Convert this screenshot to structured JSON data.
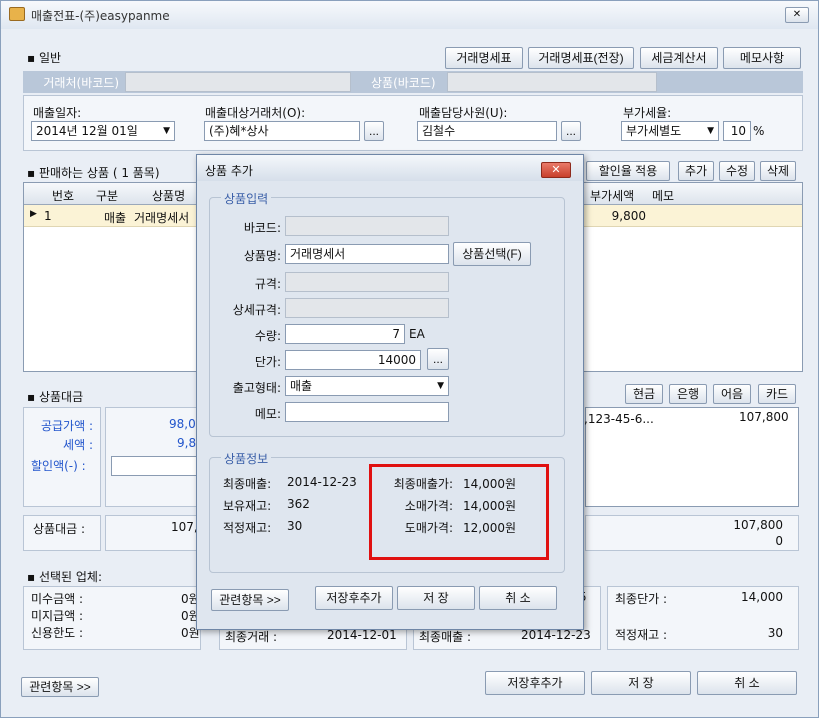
{
  "window": {
    "title": "매출전표-(주)easypanme",
    "close_glyph": "✕"
  },
  "general": {
    "section_label": "▪ 일반",
    "buttons": [
      "거래명세표",
      "거래명세표(전장)",
      "세금계산서",
      "메모사항"
    ],
    "customer_barcode_label": "거래처(바코드)",
    "product_barcode_label": "상품(바코드)",
    "sales_date_label": "매출일자:",
    "sales_date": "2014년 12월 01일",
    "customer_label": "매출대상거래처(O):",
    "customer": "(주)혜*상사",
    "staff_label": "매출담당사원(U):",
    "staff": "김철수",
    "vat_label": "부가세율:",
    "vat_mode": "부가세별도",
    "vat_rate": "10",
    "vat_unit": "%"
  },
  "items": {
    "section_label": "▪ 판매하는 상품 ( 1 품목)",
    "buttons": [
      "할인율 적용",
      "추가",
      "수정",
      "삭제"
    ],
    "columns": [
      "번호",
      "구분",
      "상품명",
      "부가세액",
      "메모"
    ],
    "rows": [
      {
        "no": "1",
        "type": "매출",
        "name": "거래명세서",
        "vat": "9,800",
        "memo": ""
      }
    ]
  },
  "payment": {
    "section_label": "▪ 상품대금",
    "buttons": [
      "현금",
      "은행",
      "어음",
      "카드"
    ],
    "supply_label": "공급가액 :",
    "supply_value": "98,0",
    "tax_label": "세액 :",
    "tax_value": "9,8",
    "discount_label": "할인액(-) :",
    "account_text": "은,123-45-6...",
    "account_amount": "107,800",
    "total_label": "상품대금 :",
    "total_value": "107,8",
    "right_total_1": "107,800",
    "right_total_2": "0"
  },
  "selected": {
    "section_label": "▪ 선택된 업체:",
    "unpaid_label": "미수금액 :",
    "unpaid_value": "0원",
    "unpaid2_label": "미지급액 :",
    "unpaid2_value": "0원",
    "credit_label": "신용한도 :",
    "credit_value": "0원",
    "last_price_label": "최종단가 :",
    "last_price_value": "14,000",
    "proper_stock_label": "적정재고 :",
    "proper_stock_value": "30",
    "bg_left_label": "최종거래 :",
    "bg_left_value": "2014-12-01",
    "bg_mid_label": "최종매출 :",
    "bg_mid_value": "2014-12-23",
    "bg_right_value": "5"
  },
  "footer": {
    "related": "관련항목 >>",
    "save_add": "저장후추가",
    "save": "저 장",
    "cancel": "취 소"
  },
  "dialog": {
    "title": "상품 추가",
    "input_group": "상품입력",
    "barcode_label": "바코드:",
    "barcode": "",
    "name_label": "상품명:",
    "name": "거래명세서",
    "select_button": "상품선택(F)",
    "spec_label": "규격:",
    "detail_spec_label": "상세규격:",
    "qty_label": "수량:",
    "qty": "7",
    "qty_unit": "EA",
    "price_label": "단가:",
    "price": "14000",
    "ellipsis": "...",
    "ship_label": "출고형태:",
    "ship": "매출",
    "memo_label": "메모:",
    "info_group": "상품정보",
    "last_sale_label": "최종매출:",
    "last_sale": "2014-12-23",
    "stock_label": "보유재고:",
    "stock": "362",
    "proper_label": "적정재고:",
    "proper": "30",
    "last_sale_price_label": "최종매출가:",
    "last_sale_price": "14,000원",
    "retail_label": "소매가격:",
    "retail": "14,000원",
    "wholesale_label": "도매가격:",
    "wholesale": "12,000원",
    "related": "관련항목 >>",
    "save_add": "저장후추가",
    "save": "저 장",
    "cancel": "취 소",
    "highlight_color": "#e01010"
  }
}
